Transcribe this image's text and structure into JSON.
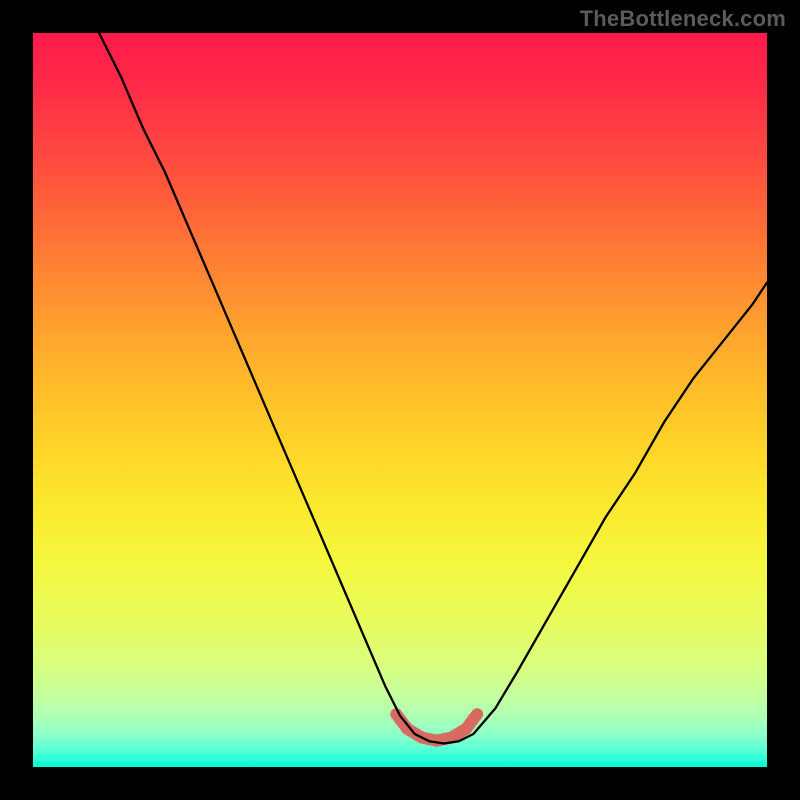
{
  "watermark": "TheBottleneck.com",
  "chart_data": {
    "type": "line",
    "title": "",
    "xlabel": "",
    "ylabel": "",
    "xlim": [
      0,
      100
    ],
    "ylim": [
      0,
      100
    ],
    "grid": false,
    "series": [
      {
        "name": "bottleneck-curve",
        "color": "#000000",
        "x": [
          9,
          12,
          15,
          18,
          21,
          24,
          27,
          30,
          33,
          36,
          39,
          42,
          45,
          48,
          50,
          52,
          54,
          56,
          58,
          60,
          63,
          66,
          70,
          74,
          78,
          82,
          86,
          90,
          94,
          98,
          100
        ],
        "y": [
          100,
          94,
          87,
          81,
          74,
          67,
          60,
          53,
          46,
          39,
          32,
          25,
          18,
          11,
          7,
          4.5,
          3.5,
          3.2,
          3.5,
          4.5,
          8,
          13,
          20,
          27,
          34,
          40,
          47,
          53,
          58,
          63,
          66
        ]
      }
    ],
    "highlight": {
      "name": "optimal-range",
      "color": "#d86a62",
      "x": [
        49.5,
        51,
        53,
        55,
        57,
        59,
        60.5
      ],
      "y": [
        7.2,
        5.2,
        4.0,
        3.6,
        4.0,
        5.2,
        7.2
      ]
    }
  },
  "colors": {
    "background": "#000000",
    "watermark": "#5b5b5b",
    "curve": "#000000",
    "highlight": "#d86a62"
  }
}
